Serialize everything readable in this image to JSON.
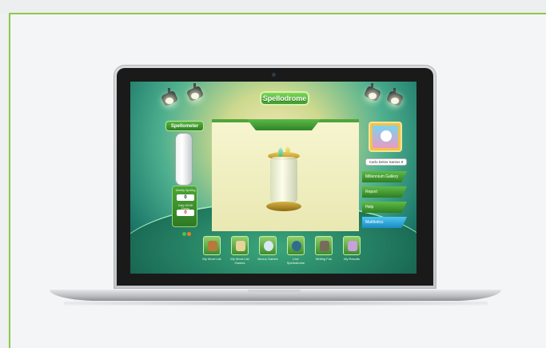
{
  "app": {
    "title": "Spellodrome"
  },
  "spellometer": {
    "label": "Spellometer",
    "weekly_label": "Weekly Spelling",
    "weekly_value": "0",
    "daily_label": "Daily WOW Points",
    "daily_value": "0"
  },
  "profile": {
    "name": "Carlo Delos Santos 9"
  },
  "menu": [
    {
      "label": "Millennium Gallery"
    },
    {
      "label": "Report"
    },
    {
      "label": "Help"
    },
    {
      "label": "Mathletics"
    }
  ],
  "bottom_nav": [
    {
      "label": "My Word List",
      "icon": "books-icon"
    },
    {
      "label": "My Word List Games",
      "icon": "scroll-icon"
    },
    {
      "label": "Bonus Games",
      "icon": "balloon-icon"
    },
    {
      "label": "Live Spellodrome",
      "icon": "globe-icon"
    },
    {
      "label": "Writing Fun",
      "icon": "writing-icon"
    },
    {
      "label": "My Results",
      "icon": "trophy-icon"
    }
  ],
  "colors": {
    "frame_border": "#8cc94a",
    "accent_green": "#4fa53a",
    "accent_blue": "#1a8bc4",
    "stage_bg": "#f6f5cf"
  }
}
